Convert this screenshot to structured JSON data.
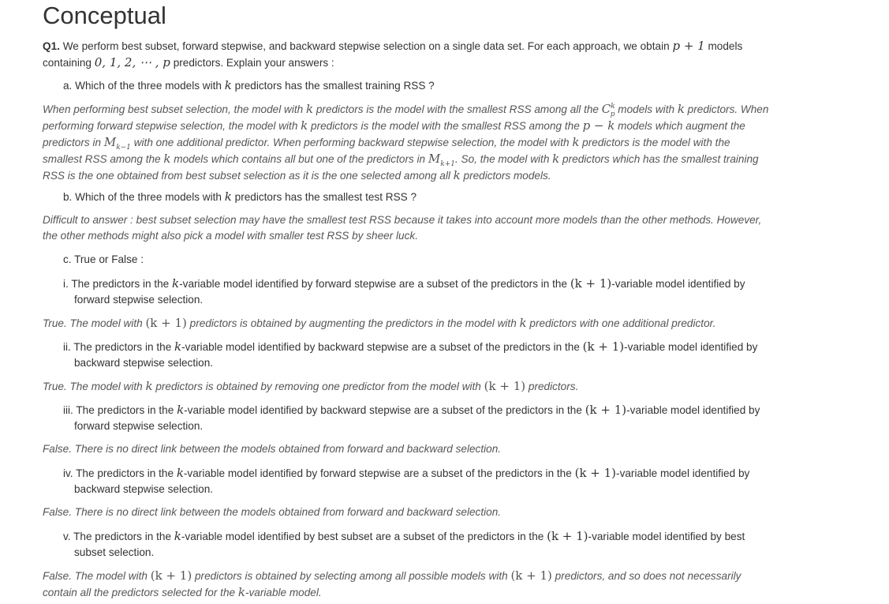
{
  "title": "Conceptual",
  "q1": {
    "label": "Q1.",
    "text_a": " We perform best subset, forward stepwise, and backward stepwise selection on a single data set. For each approach, we obtain ",
    "m_p1": "p + 1",
    "text_b": " models containing ",
    "m_list": "0, 1, 2, ⋯ , p",
    "text_c": " predictors. Explain your answers :"
  },
  "a": {
    "q_pre": "a. Which of the three models with ",
    "q_k": "k",
    "q_post": " predictors has the smallest training RSS ?",
    "ans": {
      "t1": "When performing best subset selection, the model with ",
      "k": "k",
      "t2": " predictors is the model with the smallest RSS among all the ",
      "c_base": "C",
      "c_sup": "k",
      "c_sub": "p",
      "t3": " models with ",
      "t4": " predictors. When performing forward stepwise selection, the model with ",
      "t5": " predictors is the model with the smallest RSS among the ",
      "m_pk": "p − k",
      "t6": " models which augment the predictors in ",
      "M": "M",
      "sub_km1": "k−1",
      "t7": " with one additional predictor. When performing backward stepwise selection, the model with ",
      "t8": " predictors is the model with the smallest RSS among the ",
      "t9": " models which contains all but one of the predictors in ",
      "sub_kp1": "k+1",
      "t10": ". So, the model with ",
      "t11": " predictors which has the smallest training RSS is the one obtained from best subset selection as it is the one selected among all ",
      "t12": " predictors models."
    }
  },
  "b": {
    "q_pre": "b. Which of the three models with ",
    "q_k": "k",
    "q_post": " predictors has the smallest test RSS ?",
    "ans": "Difficult to answer : best subset selection may have the smallest test RSS because it takes into account more models than the other methods. However, the other methods might also pick a model with smaller test RSS by sheer luck."
  },
  "c": {
    "label": "c. True or False :",
    "items": [
      {
        "q_pre": "i. The predictors in the ",
        "k": "k",
        "q_mid": "-variable model identified by forward stepwise are a subset of the predictors in the ",
        "kp1": "(k + 1)",
        "q_post": "-variable model identified by forward stepwise selection.",
        "ans": {
          "t1": "True. The model with ",
          "kp1": "(k + 1)",
          "t2": " predictors is obtained by augmenting the predictors in the model with ",
          "k": "k",
          "t3": " predictors with one additional predictor."
        }
      },
      {
        "q_pre": "ii. The predictors in the ",
        "k": "k",
        "q_mid": "-variable model identified by backward stepwise are a subset of the predictors in the ",
        "kp1": "(k + 1)",
        "q_post": "-variable model identified by backward stepwise selection.",
        "ans": {
          "t1": "True. The model with ",
          "k": "k",
          "t2": " predictors is obtained by removing one predictor from the model with ",
          "kp1": "(k + 1)",
          "t3": " predictors."
        }
      },
      {
        "q_pre": "iii. The predictors in the ",
        "k": "k",
        "q_mid": "-variable model identified by backward stepwise are a subset of the predictors in the ",
        "kp1": "(k + 1)",
        "q_post": "-variable model identified by forward stepwise selection.",
        "ans": "False. There is no direct link between the models obtained from forward and backward selection."
      },
      {
        "q_pre": "iv. The predictors in the ",
        "k": "k",
        "q_mid": "-variable model identified by forward stepwise are a subset of the predictors in the ",
        "kp1": "(k + 1)",
        "q_post": "-variable model identified by backward stepwise selection.",
        "ans": "False. There is no direct link between the models obtained from forward and backward selection."
      },
      {
        "q_pre": "v. The predictors in the ",
        "k": "k",
        "q_mid": "-variable model identified by best subset are a subset of the predictors in the ",
        "kp1": "(k + 1)",
        "q_post": "-variable model identified by best subset selection.",
        "ans": {
          "t1": "False. The model with ",
          "kp1": "(k + 1)",
          "t2": " predictors is obtained by selecting among all possible models with ",
          "kp1b": "(k + 1)",
          "t3": " predictors, and so does not necessarily contain all the predictors selected for the ",
          "k": "k",
          "t4": "-variable model."
        }
      }
    ]
  }
}
